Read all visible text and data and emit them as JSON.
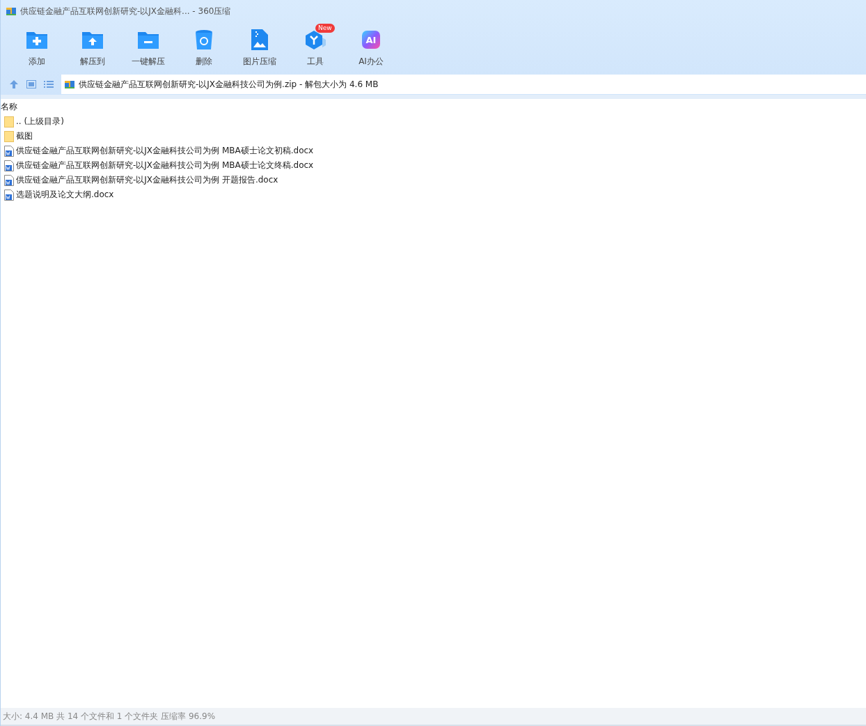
{
  "window": {
    "title": "供应链金融产品互联网创新研究-以JX金融科... - 360压缩"
  },
  "toolbar": [
    {
      "kind": "add",
      "label": "添加"
    },
    {
      "kind": "extract",
      "label": "解压到"
    },
    {
      "kind": "oneclick",
      "label": "一键解压"
    },
    {
      "kind": "delete",
      "label": "删除"
    },
    {
      "kind": "image",
      "label": "图片压缩"
    },
    {
      "kind": "tools",
      "label": "工具",
      "badge": "New"
    },
    {
      "kind": "ai",
      "label": "AI办公",
      "icon_text": "AI"
    }
  ],
  "address": {
    "path": "供应链金融产品互联网创新研究-以JX金融科技公司为例.zip - 解包大小为 4.6 MB"
  },
  "table": {
    "columns": [
      "名称"
    ],
    "rows": [
      {
        "kind": "folder",
        "name": ".. (上级目录)"
      },
      {
        "kind": "folder",
        "name": "截图"
      },
      {
        "kind": "doc",
        "name": "供应链金融产品互联网创新研究-以JX金融科技公司为例 MBA硕士论文初稿.docx"
      },
      {
        "kind": "doc",
        "name": "供应链金融产品互联网创新研究-以JX金融科技公司为例 MBA硕士论文终稿.docx"
      },
      {
        "kind": "doc",
        "name": "供应链金融产品互联网创新研究-以JX金融科技公司为例 开题报告.docx"
      },
      {
        "kind": "doc",
        "name": "选题说明及论文大纲.docx"
      }
    ]
  },
  "status_bar": "大小: 4.4 MB 共 14 个文件和 1 个文件夹 压缩率 96.9%"
}
